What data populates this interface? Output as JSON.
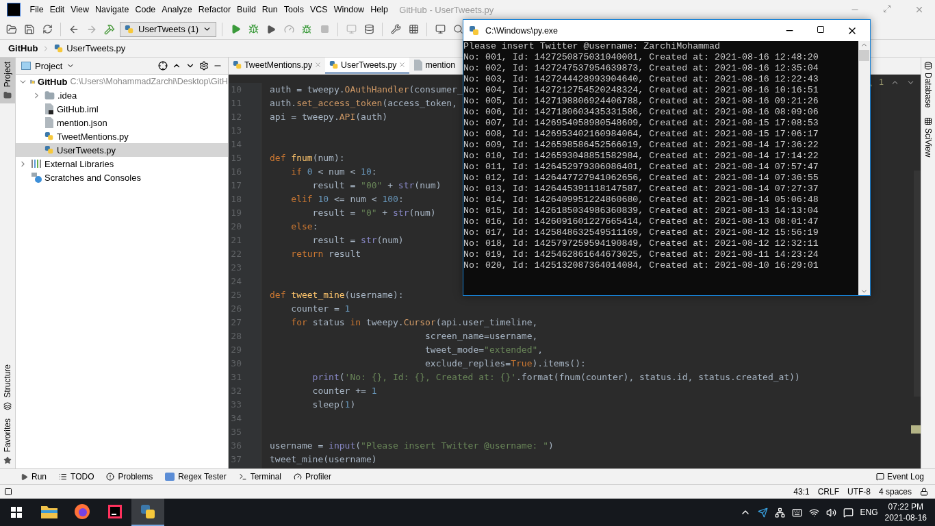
{
  "ide": {
    "title": "GitHub - UserTweets.py",
    "menu": [
      "File",
      "Edit",
      "View",
      "Navigate",
      "Code",
      "Analyze",
      "Refactor",
      "Build",
      "Run",
      "Tools",
      "VCS",
      "Window",
      "Help"
    ],
    "run_config": "UserTweets (1)",
    "breadcrumb": [
      "GitHub",
      "UserTweets.py"
    ],
    "left_strip": [
      {
        "label": "Project",
        "selected": true,
        "kind": "top"
      },
      {
        "label": "Structure",
        "selected": false,
        "kind": "bottom"
      },
      {
        "label": "Favorites",
        "selected": false,
        "kind": "bottom"
      }
    ],
    "project_panel": {
      "title": "Project",
      "tree": [
        {
          "label": "GitHub",
          "path": "C:\\Users\\MohammadZarchi\\Desktop\\GitH",
          "kind": "project",
          "expanded": true,
          "selected": false,
          "children": [
            {
              "label": ".idea",
              "kind": "folder",
              "expanded": false,
              "selected": false
            },
            {
              "label": "GitHub.iml",
              "kind": "iml",
              "selected": false
            },
            {
              "label": "mention.json",
              "kind": "json",
              "selected": false
            },
            {
              "label": "TweetMentions.py",
              "kind": "python",
              "selected": false
            },
            {
              "label": "UserTweets.py",
              "kind": "python",
              "selected": true
            }
          ]
        },
        {
          "label": "External Libraries",
          "kind": "libraries",
          "expanded": false,
          "selected": false
        },
        {
          "label": "Scratches and Consoles",
          "kind": "scratches",
          "selected": false
        }
      ]
    },
    "editor": {
      "tabs": [
        {
          "label": "TweetMentions.py",
          "kind": "python",
          "selected": false
        },
        {
          "label": "UserTweets.py",
          "kind": "python",
          "selected": true
        },
        {
          "label": "mention",
          "kind": "json",
          "selected": false
        }
      ],
      "warnings": "1",
      "lines": [
        {
          "number": "10",
          "tokens": [
            {
              "kind": "plain",
              "text": "auth = tweepy."
            },
            {
              "kind": "call",
              "text": "OAuthHandler"
            },
            {
              "kind": "plain",
              "text": "(consumer_"
            }
          ]
        },
        {
          "number": "11",
          "tokens": [
            {
              "kind": "plain",
              "text": "auth."
            },
            {
              "kind": "call",
              "text": "set_access_token"
            },
            {
              "kind": "plain",
              "text": "(access_token,"
            }
          ]
        },
        {
          "number": "12",
          "tokens": [
            {
              "kind": "plain",
              "text": "api = tweepy."
            },
            {
              "kind": "call",
              "text": "API"
            },
            {
              "kind": "plain",
              "text": "(auth)"
            }
          ]
        },
        {
          "number": "13"
        },
        {
          "number": "14"
        },
        {
          "number": "15",
          "tokens": [
            {
              "kind": "keyword",
              "text": "def "
            },
            {
              "kind": "definition",
              "text": "fnum"
            },
            {
              "kind": "plain",
              "text": "(num):"
            }
          ]
        },
        {
          "number": "16",
          "tokens": [
            {
              "kind": "keyword",
              "text": "    if "
            },
            {
              "kind": "number",
              "text": "0"
            },
            {
              "kind": "plain",
              "text": " < num < "
            },
            {
              "kind": "number",
              "text": "10"
            },
            {
              "kind": "plain",
              "text": ":"
            }
          ]
        },
        {
          "number": "17",
          "tokens": [
            {
              "kind": "plain",
              "text": "        result = "
            },
            {
              "kind": "string",
              "text": "\"00\""
            },
            {
              "kind": "plain",
              "text": " + "
            },
            {
              "kind": "builtin",
              "text": "str"
            },
            {
              "kind": "plain",
              "text": "(num)"
            }
          ]
        },
        {
          "number": "18",
          "tokens": [
            {
              "kind": "keyword",
              "text": "    elif "
            },
            {
              "kind": "number",
              "text": "10"
            },
            {
              "kind": "plain",
              "text": " <= num < "
            },
            {
              "kind": "number",
              "text": "100"
            },
            {
              "kind": "plain",
              "text": ":"
            }
          ]
        },
        {
          "number": "19",
          "tokens": [
            {
              "kind": "plain",
              "text": "        result = "
            },
            {
              "kind": "string",
              "text": "\"0\""
            },
            {
              "kind": "plain",
              "text": " + "
            },
            {
              "kind": "builtin",
              "text": "str"
            },
            {
              "kind": "plain",
              "text": "(num)"
            }
          ]
        },
        {
          "number": "20",
          "tokens": [
            {
              "kind": "keyword",
              "text": "    else"
            },
            {
              "kind": "plain",
              "text": ":"
            }
          ]
        },
        {
          "number": "21",
          "tokens": [
            {
              "kind": "plain",
              "text": "        result = "
            },
            {
              "kind": "builtin",
              "text": "str"
            },
            {
              "kind": "plain",
              "text": "(num)"
            }
          ]
        },
        {
          "number": "22",
          "tokens": [
            {
              "kind": "keyword",
              "text": "    return "
            },
            {
              "kind": "plain",
              "text": "result"
            }
          ]
        },
        {
          "number": "23"
        },
        {
          "number": "24"
        },
        {
          "number": "25",
          "tokens": [
            {
              "kind": "keyword",
              "text": "def "
            },
            {
              "kind": "definition",
              "text": "tweet_mine"
            },
            {
              "kind": "plain",
              "text": "(username):"
            }
          ]
        },
        {
          "number": "26",
          "tokens": [
            {
              "kind": "plain",
              "text": "    counter = "
            },
            {
              "kind": "number",
              "text": "1"
            }
          ]
        },
        {
          "number": "27",
          "tokens": [
            {
              "kind": "keyword",
              "text": "    for "
            },
            {
              "kind": "plain",
              "text": "status "
            },
            {
              "kind": "keyword",
              "text": "in "
            },
            {
              "kind": "plain",
              "text": "tweepy."
            },
            {
              "kind": "call",
              "text": "Cursor"
            },
            {
              "kind": "plain",
              "text": "(api.user_timeline,"
            }
          ]
        },
        {
          "number": "28",
          "tokens": [
            {
              "kind": "plain",
              "text": "                             screen_name=username,"
            }
          ]
        },
        {
          "number": "29",
          "tokens": [
            {
              "kind": "plain",
              "text": "                             tweet_mode="
            },
            {
              "kind": "string",
              "text": "\"extended\""
            },
            {
              "kind": "plain",
              "text": ","
            }
          ]
        },
        {
          "number": "30",
          "tokens": [
            {
              "kind": "plain",
              "text": "                             exclude_replies="
            },
            {
              "kind": "keyword",
              "text": "True"
            },
            {
              "kind": "plain",
              "text": ").items():"
            }
          ]
        },
        {
          "number": "31",
          "tokens": [
            {
              "kind": "builtin",
              "text": "        print"
            },
            {
              "kind": "plain",
              "text": "("
            },
            {
              "kind": "string",
              "text": "'No: {}, Id: {}, Created at: {}'"
            },
            {
              "kind": "plain",
              "text": ".format(fnum(counter), status.id, status.created_at))"
            }
          ]
        },
        {
          "number": "32",
          "tokens": [
            {
              "kind": "plain",
              "text": "        counter += "
            },
            {
              "kind": "number",
              "text": "1"
            }
          ]
        },
        {
          "number": "33",
          "tokens": [
            {
              "kind": "plain",
              "text": "        sleep("
            },
            {
              "kind": "number",
              "text": "1"
            },
            {
              "kind": "plain",
              "text": ")"
            }
          ]
        },
        {
          "number": "34"
        },
        {
          "number": "35"
        },
        {
          "number": "36",
          "tokens": [
            {
              "kind": "plain",
              "text": "username = "
            },
            {
              "kind": "builtin",
              "text": "input"
            },
            {
              "kind": "plain",
              "text": "("
            },
            {
              "kind": "string",
              "text": "\"Please insert Twitter @username: \""
            },
            {
              "kind": "plain",
              "text": ")"
            }
          ]
        },
        {
          "number": "37",
          "tokens": [
            {
              "kind": "plain",
              "text": "tweet_mine(username)"
            }
          ]
        }
      ]
    },
    "right_strip": [
      "Database",
      "SciView"
    ],
    "tool_tabs": [
      {
        "label": "Run",
        "kind": "run"
      },
      {
        "label": "TODO",
        "kind": "todo"
      },
      {
        "label": "Problems",
        "kind": "problems"
      },
      {
        "label": "Regex Tester",
        "kind": "regex"
      },
      {
        "label": "Terminal",
        "kind": "terminal"
      },
      {
        "label": "Profiler",
        "kind": "profiler"
      }
    ],
    "event_log": "Event Log",
    "status": [
      "43:1",
      "CRLF",
      "UTF-8",
      "4 spaces"
    ]
  },
  "console": {
    "title": "C:\\Windows\\py.exe",
    "lines": [
      "Please insert Twitter @username: ZarchiMohammad",
      "No: 001, Id: 1427250875031040001, Created at: 2021-08-16 12:48:20",
      "No: 002, Id: 1427247537954639873, Created at: 2021-08-16 12:35:04",
      "No: 003, Id: 1427244428993904640, Created at: 2021-08-16 12:22:43",
      "No: 004, Id: 1427212754520248324, Created at: 2021-08-16 10:16:51",
      "No: 005, Id: 1427198806924406788, Created at: 2021-08-16 09:21:26",
      "No: 006, Id: 1427180603435331586, Created at: 2021-08-16 08:09:06",
      "No: 007, Id: 1426954058980548609, Created at: 2021-08-15 17:08:53",
      "No: 008, Id: 1426953402160984064, Created at: 2021-08-15 17:06:17",
      "No: 009, Id: 1426598586452566019, Created at: 2021-08-14 17:36:22",
      "No: 010, Id: 1426593048851582984, Created at: 2021-08-14 17:14:22",
      "No: 011, Id: 1426452979306086401, Created at: 2021-08-14 07:57:47",
      "No: 012, Id: 1426447727941062656, Created at: 2021-08-14 07:36:55",
      "No: 013, Id: 1426445391118147587, Created at: 2021-08-14 07:27:37",
      "No: 014, Id: 1426409951224860680, Created at: 2021-08-14 05:06:48",
      "No: 015, Id: 1426185034986360839, Created at: 2021-08-13 14:13:04",
      "No: 016, Id: 1426091601227665414, Created at: 2021-08-13 08:01:47",
      "No: 017, Id: 1425848632549511169, Created at: 2021-08-12 15:56:19",
      "No: 018, Id: 1425797259594190849, Created at: 2021-08-12 12:32:11",
      "No: 019, Id: 1425462861644673025, Created at: 2021-08-11 14:23:24",
      "No: 020, Id: 1425132087364014084, Created at: 2021-08-10 16:29:01"
    ]
  },
  "taskbar": {
    "apps": [
      {
        "kind": "explorer",
        "selected": false
      },
      {
        "kind": "firefox",
        "selected": false
      },
      {
        "kind": "intellij",
        "selected": false
      },
      {
        "kind": "python",
        "selected": true
      }
    ],
    "language": "ENG",
    "time": "07:22 PM",
    "date": "2021-08-16"
  }
}
